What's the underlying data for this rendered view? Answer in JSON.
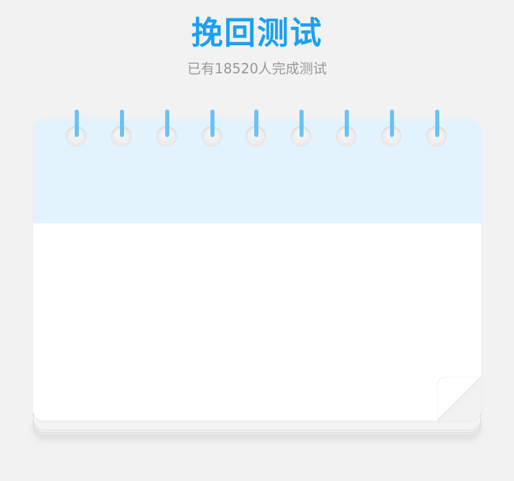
{
  "header": {
    "title": "挽回测试",
    "subtitle": "已有18520人完成测试"
  },
  "colors": {
    "accent": "#1ba0f2",
    "ring": "#69c2f5",
    "notebook_header": "#e3f3fe",
    "page": "#ffffff",
    "background": "#f2f2f2"
  },
  "notebook": {
    "ring_count": 9,
    "icons": [
      "binder-ring-icon",
      "page-curl-icon"
    ]
  }
}
